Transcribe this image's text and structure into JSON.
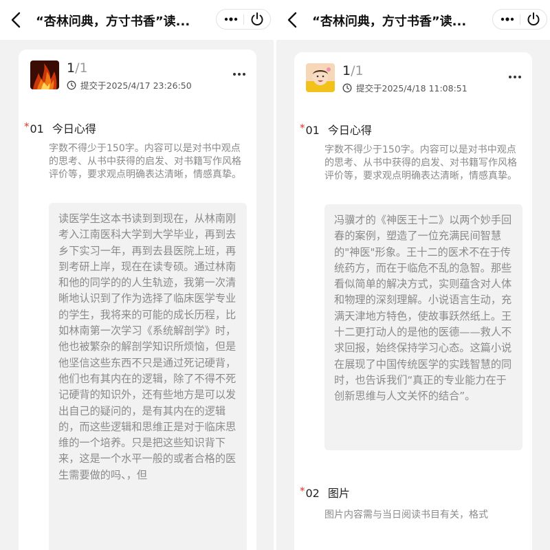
{
  "left": {
    "title": "“杏林问典，方寸书香”读...",
    "page_current": "1",
    "page_total": "/1",
    "submit_time": "提交于2025/4/17 23:26:50",
    "question": {
      "required_mark": "*",
      "number": "01",
      "title": "今日心得",
      "description": "字数不得少于150字。内容可以是对书中观点的思考、从书中获得的启发、对书籍写作风格评价等，要求观点明确表达清晰，情感真挚。",
      "answer": "读医学生这本书读到到现在，从林南刚考入江南医科大学到大学毕业，再到去乡下实习一年，再到去县医院上班，再到考研上岸，现在在读专硕。通过林南和他的同学的的人生轨迹，我第一次清晰地认识到了作为选择了临床医学专业的学生，我将来的可能的成长历程，比如林南第一次学习《系统解剖学》时，他也被繁杂的解剖学知识所烦恼，但是他坚信这些东西不只是通过死记硬背，他们也有其内在的逻辑，除了不得不死记硬背的知识外，还有些地方是可以发出自己的疑问的，是有其内在的逻辑的，而这些逻辑和思维正是对于临床思维的一个培养。只是把这些知识背下来，这是一个水平一般的或者合格的医生需要做的吗、，但"
    }
  },
  "right": {
    "title": "“杏林问典，方寸书香”读...",
    "page_current": "1",
    "page_total": "/1",
    "submit_time": "提交于2025/4/18 11:08:51",
    "question": {
      "required_mark": "*",
      "number": "01",
      "title": "今日心得",
      "description": "字数不得少于150字。内容可以是对书中观点的思考、从书中获得的启发、对书籍写作风格评价等，要求观点明确表达清晰，情感真挚。",
      "answer": "冯骥才的《神医王十二》以两个妙手回春的案例，塑造了一位充满民间智慧的\"神医\"形象。王十二的医术不在于传统药方，而在于临危不乱的急智。那些看似简单的解决方式，实则蕴含对人体和物理的深刻理解。小说语言生动，充满天津地方特色，使故事跃然纸上。王十二更打动人的是他的医德——救人不求回报，始终保持学习心态。这篇小说在展现了中国传统医学的实践智慧的同时，也告诉我们“真正的专业能力在于创新思维与人文关怀的结合”。"
    },
    "question2": {
      "required_mark": "*",
      "number": "02",
      "title": "图片",
      "description": "图片内容需与当日阅读书目有关，格式"
    }
  },
  "colors": {
    "required_star": "#e4352a",
    "muted_text": "#8a8a8a",
    "page_background": "#f2f2f2",
    "card_background": "#ffffff"
  },
  "icons": {
    "back": "chevron-left-icon",
    "more": "more-dots-icon",
    "power": "power-icon",
    "clock": "clock-icon",
    "avatar_left": "fire-avatar",
    "avatar_right": "baby-photo-avatar"
  }
}
